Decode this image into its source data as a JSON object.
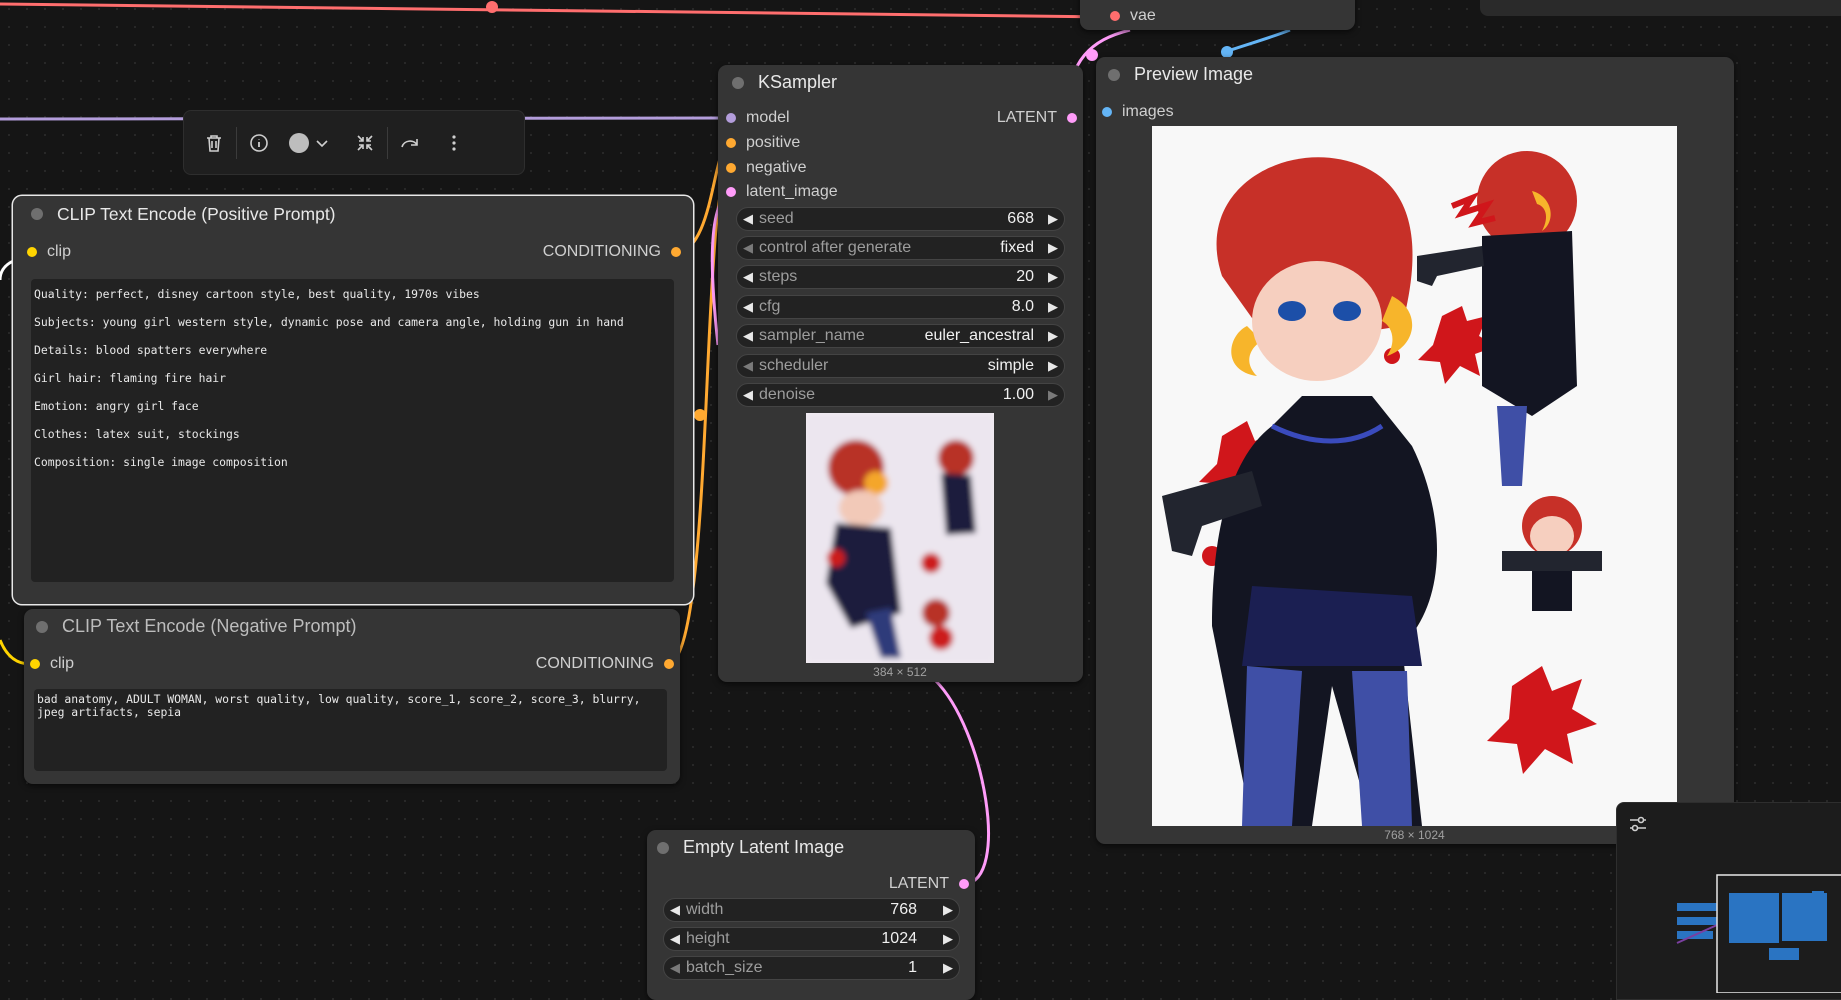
{
  "colors": {
    "model": "#b39ddb",
    "clip": "#ffd400",
    "conditioning": "#ffa931",
    "latent": "#ff9cf9",
    "vae": "#ff6e6e",
    "image": "#64b5f6"
  },
  "toolbar": {
    "icons": [
      "trash-icon",
      "info-icon",
      "color-circle-icon",
      "chevron-down-icon",
      "collapse-icon",
      "bypass-icon",
      "more-icon"
    ]
  },
  "top_vae": {
    "label": "vae"
  },
  "ksampler": {
    "title": "KSampler",
    "inputs": [
      "model",
      "positive",
      "negative",
      "latent_image"
    ],
    "output": "LATENT",
    "widgets": [
      {
        "label": "seed",
        "value": "668"
      },
      {
        "label": "control after generate",
        "value": "fixed"
      },
      {
        "label": "steps",
        "value": "20"
      },
      {
        "label": "cfg",
        "value": "8.0"
      },
      {
        "label": "sampler_name",
        "value": "euler_ancestral"
      },
      {
        "label": "scheduler",
        "value": "simple"
      },
      {
        "label": "denoise",
        "value": "1.00"
      }
    ],
    "preview_size": "384 × 512"
  },
  "positive": {
    "title": "CLIP Text Encode (Positive Prompt)",
    "input": "clip",
    "output": "CONDITIONING",
    "lines": [
      "Quality: perfect, disney cartoon style, best quality, 1970s vibes",
      "Subjects: young girl western style, dynamic pose and camera angle, holding gun in hand",
      "Details: blood spatters everywhere",
      "Girl hair: flaming fire hair",
      "Emotion: angry girl face",
      "Clothes: latex suit, stockings",
      "Composition: single image composition"
    ]
  },
  "negative": {
    "title": "CLIP Text Encode (Negative Prompt)",
    "input": "clip",
    "output": "CONDITIONING",
    "text": "bad anatomy, ADULT WOMAN, worst quality, low quality, score_1, score_2, score_3, blurry, jpeg artifacts, sepia"
  },
  "preview": {
    "title": "Preview Image",
    "input": "images",
    "size": "768 × 1024"
  },
  "empty_latent": {
    "title": "Empty Latent Image",
    "output": "LATENT",
    "widgets": [
      {
        "label": "width",
        "value": "768"
      },
      {
        "label": "height",
        "value": "1024"
      },
      {
        "label": "batch_size",
        "value": "1"
      }
    ]
  },
  "minimap": {
    "icon": "settings-sliders-icon"
  }
}
